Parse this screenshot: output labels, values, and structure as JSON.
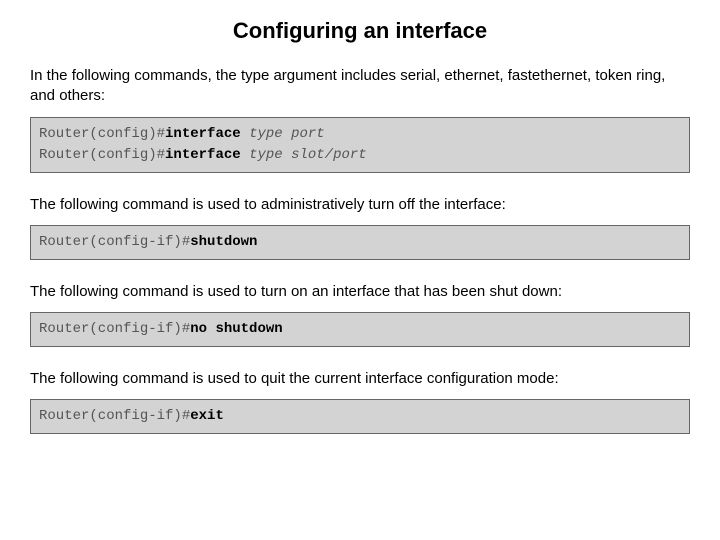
{
  "title": "Configuring an interface",
  "sections": [
    {
      "desc": "In the following commands, the type argument includes serial, ethernet, fastethernet, token ring, and others:",
      "commands": [
        {
          "prompt": "Router(config)#",
          "cmd": "interface",
          "arg": "type port"
        },
        {
          "prompt": "Router(config)#",
          "cmd": "interface",
          "arg": "type slot/port"
        }
      ]
    },
    {
      "desc": "The following command is used to administratively turn off the interface:",
      "commands": [
        {
          "prompt": "Router(config-if)#",
          "cmd": "shutdown",
          "arg": ""
        }
      ]
    },
    {
      "desc": "The following command is used to turn on an interface that has been shut down:",
      "commands": [
        {
          "prompt": "Router(config-if)#",
          "cmd": "no shutdown",
          "arg": ""
        }
      ]
    },
    {
      "desc": "The following command is used to quit the current interface configuration mode:",
      "commands": [
        {
          "prompt": "Router(config-if)#",
          "cmd": "exit",
          "arg": ""
        }
      ]
    }
  ]
}
